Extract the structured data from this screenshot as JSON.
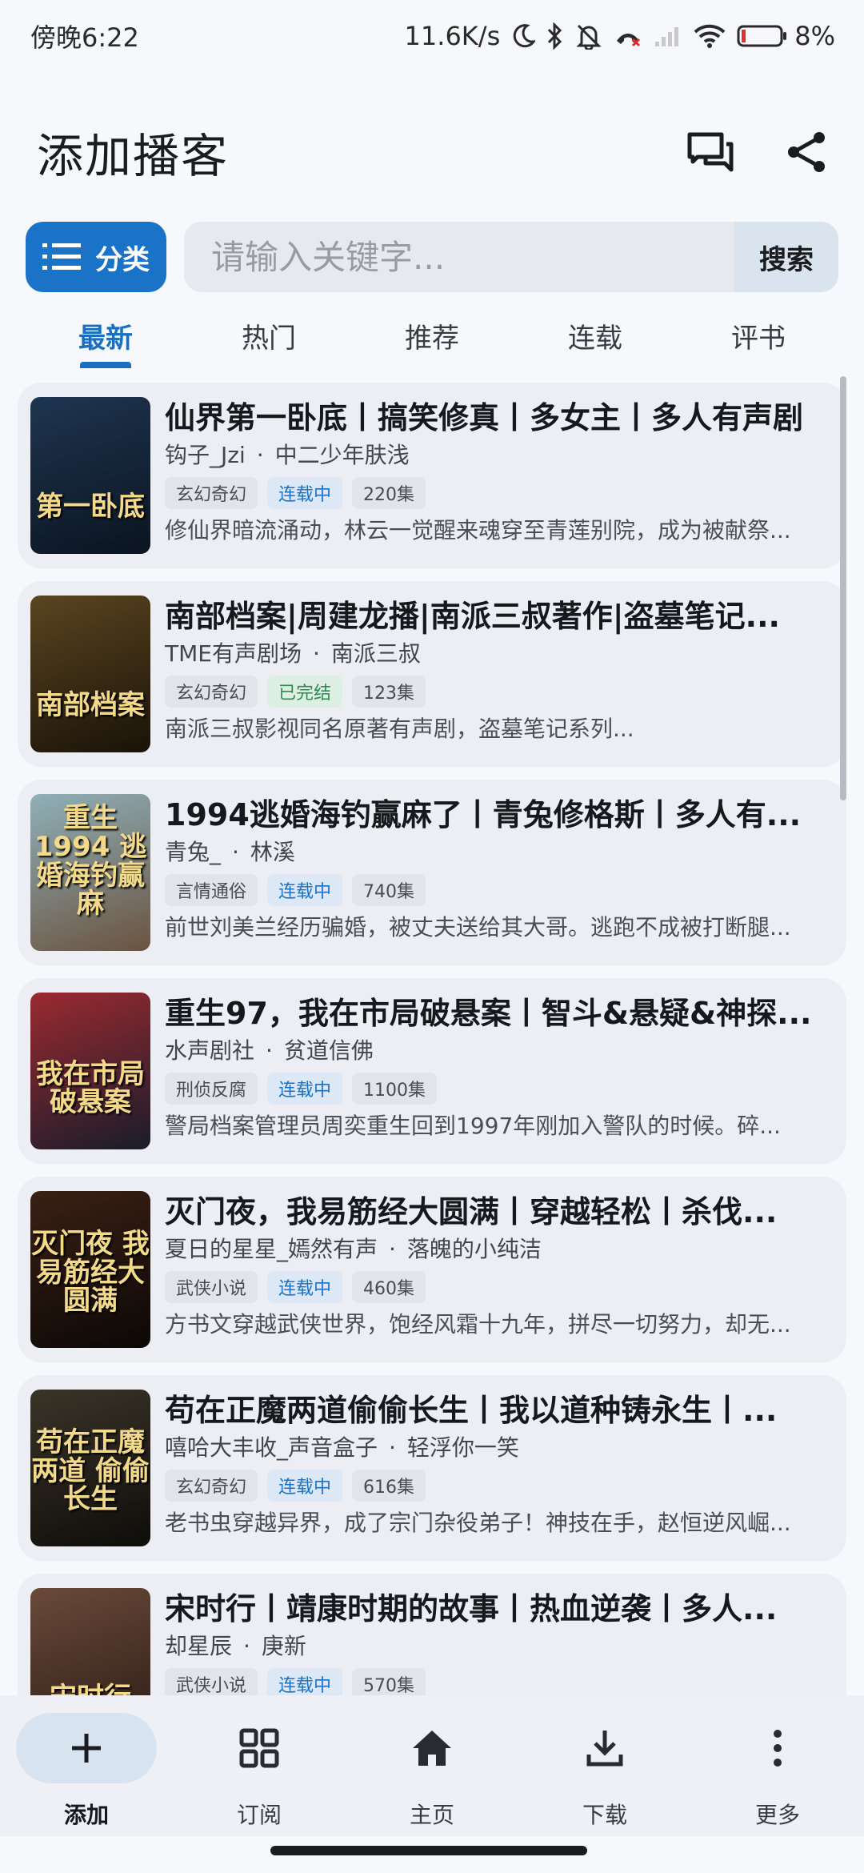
{
  "status": {
    "time": "傍晚6:22",
    "speed": "11.6K/s",
    "battery": "8%"
  },
  "header": {
    "title": "添加播客"
  },
  "search": {
    "category_label": "分类",
    "placeholder": "请输入关键字...",
    "button": "搜索"
  },
  "tabs": [
    {
      "label": "最新",
      "active": true
    },
    {
      "label": "热门"
    },
    {
      "label": "推荐"
    },
    {
      "label": "连载"
    },
    {
      "label": "评书"
    }
  ],
  "items": [
    {
      "title": "仙界第一卧底丨搞笑修真丨多女主丨多人有声剧",
      "host": "钩子_Jzi",
      "author": "中二少年肤浅",
      "genre": "玄幻奇幻",
      "status": "连载中",
      "episodes": "220集",
      "desc": "修仙界暗流涌动，林云一觉醒来魂穿至青莲别院，成为被献祭...",
      "cover_text": "第一卧底",
      "colors": [
        "#1e3550",
        "#0b1420"
      ]
    },
    {
      "title": "南部档案|周建龙播|南派三叔著作|盗墓笔记...",
      "host": "TME有声剧场",
      "author": "南派三叔",
      "genre": "玄幻奇幻",
      "status": "已完结",
      "episodes": "123集",
      "desc": "南派三叔影视同名原著有声剧，盗墓笔记系列...",
      "cover_text": "南部档案",
      "colors": [
        "#5a4520",
        "#1a1208"
      ]
    },
    {
      "title": "1994逃婚海钓赢麻了丨青兔修格斯丨多人有...",
      "host": "青兔_",
      "author": "林溪",
      "genre": "言情通俗",
      "status": "连载中",
      "episodes": "740集",
      "desc": "前世刘美兰经历骗婚，被丈夫送给其大哥。逃跑不成被打断腿...",
      "cover_text": "重生1994 逃婚海钓赢麻",
      "colors": [
        "#8fb0b8",
        "#6a5340"
      ]
    },
    {
      "title": "重生97，我在市局破悬案丨智斗&悬疑&神探...",
      "host": "水声剧社",
      "author": "贫道信佛",
      "genre": "刑侦反腐",
      "status": "连载中",
      "episodes": "1100集",
      "desc": "警局档案管理员周奕重生回到1997年刚加入警队的时候。碎...",
      "cover_text": "我在市局 破悬案",
      "colors": [
        "#9a2a30",
        "#1a1c2a"
      ]
    },
    {
      "title": "灭门夜，我易筋经大圆满丨穿越轻松丨杀伐...",
      "host": "夏日的星星_嫣然有声",
      "author": "落魄的小纯洁",
      "genre": "武侠小说",
      "status": "连载中",
      "episodes": "460集",
      "desc": "方书文穿越武侠世界，饱经风霜十九年，拼尽一切努力，却无...",
      "cover_text": "灭门夜 我易筋经大圆满",
      "colors": [
        "#3a2014",
        "#0c0806"
      ]
    },
    {
      "title": "苟在正魔两道偷偷长生丨我以道种铸永生丨...",
      "host": "嘻哈大丰收_声音盒子",
      "author": "轻浮你一笑",
      "genre": "玄幻奇幻",
      "status": "连载中",
      "episodes": "616集",
      "desc": "老书虫穿越异界，成了宗门杂役弟子！神技在手，赵恒逆风崛...",
      "cover_text": "苟在正魔两道 偷偷长生",
      "colors": [
        "#3a3428",
        "#0f0d0a"
      ]
    },
    {
      "title": "宋时行丨靖康时期的故事丨热血逆袭丨多人...",
      "host": "却星辰",
      "author": "庚新",
      "genre": "武侠小说",
      "status": "连载中",
      "episodes": "570集",
      "desc": "",
      "cover_text": "宋时行",
      "colors": [
        "#6a4a3a",
        "#2a1a14"
      ]
    }
  ],
  "nav": [
    {
      "label": "添加",
      "icon": "plus-icon",
      "active": true
    },
    {
      "label": "订阅",
      "icon": "grid-icon"
    },
    {
      "label": "主页",
      "icon": "home-icon"
    },
    {
      "label": "下载",
      "icon": "download-icon"
    },
    {
      "label": "更多",
      "icon": "more-vertical-icon"
    }
  ],
  "theme": {
    "accent": "#1a73c6"
  }
}
